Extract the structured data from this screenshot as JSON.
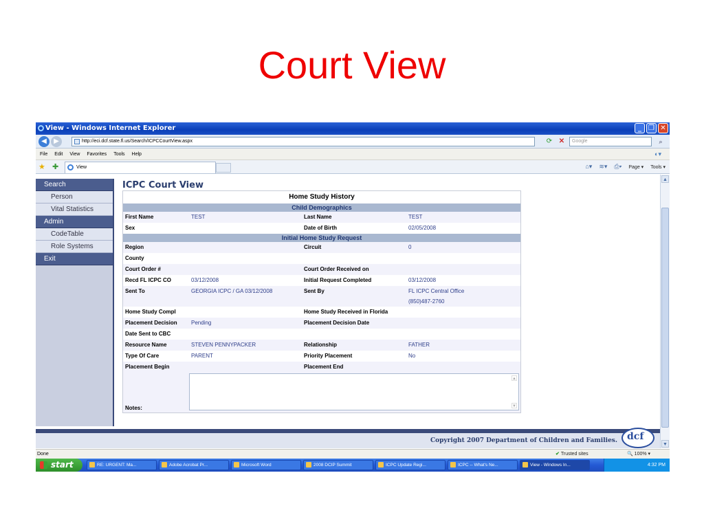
{
  "slide": {
    "title": "Court View"
  },
  "window": {
    "title": "View - Windows Internet Explorer",
    "url": "http://eci.dcf.state.fl.us/Search/ICPCCourtView.aspx",
    "search_placeholder": "Google",
    "menu": [
      "File",
      "Edit",
      "View",
      "Favorites",
      "Tools",
      "Help"
    ],
    "tab_label": "View",
    "commands": [
      "Page",
      "Tools"
    ]
  },
  "nav": {
    "sections": [
      {
        "label": "Search",
        "items": [
          "Person",
          "Vital Statistics"
        ]
      },
      {
        "label": "Admin",
        "items": [
          "CodeTable",
          "Role Systems"
        ]
      },
      {
        "label": "Exit",
        "items": []
      }
    ]
  },
  "page": {
    "title": "ICPC Court View",
    "form_title": "Home Study History",
    "section_child": "Child Demographics",
    "section_request": "Initial Home Study Request",
    "child_rows": [
      {
        "l1": "First Name",
        "v1": "TEST",
        "l2": "Last Name",
        "v2": "TEST"
      },
      {
        "l1": "Sex",
        "v1": "",
        "l2": "Date of Birth",
        "v2": "02/05/2008"
      }
    ],
    "request_rows": [
      {
        "l1": "Region",
        "v1": "",
        "l2": "Circuit",
        "v2": "0"
      },
      {
        "l1": "County",
        "v1": "",
        "l2": "",
        "v2": ""
      },
      {
        "l1": "Court Order #",
        "v1": "",
        "l2": "Court Order Received on",
        "v2": ""
      },
      {
        "l1": "Recd FL ICPC CO",
        "v1": "03/12/2008",
        "l2": "Initial Request Completed",
        "v2": "03/12/2008"
      },
      {
        "l1": "Sent To",
        "v1": "GEORGIA ICPC / GA 03/12/2008",
        "l2": "Sent By",
        "v2": "FL ICPC Central Office",
        "v2b": "(850)487-2760"
      },
      {
        "l1": "Home Study Compl",
        "v1": "",
        "l2": "Home Study Received in Florida",
        "v2": ""
      },
      {
        "l1": "Placement Decision",
        "v1": "Pending",
        "l2": "Placement Decision Date",
        "v2": ""
      },
      {
        "l1": "Date Sent to CBC",
        "v1": "",
        "l2": "",
        "v2": ""
      },
      {
        "l1": "Resource Name",
        "v1": "STEVEN PENNYPACKER",
        "l2": "Relationship",
        "v2": "FATHER"
      },
      {
        "l1": "Type Of Care",
        "v1": "PARENT",
        "l2": "Priority Placement",
        "v2": "No"
      },
      {
        "l1": "Placement Begin",
        "v1": "",
        "l2": "Placement End",
        "v2": ""
      }
    ],
    "notes_label": "Notes:",
    "copyright": "Copyright 2007 Department of Children and Families.",
    "logo_text": "dcf"
  },
  "status": {
    "left": "Done",
    "zone": "Trusted sites",
    "zoom": "100%"
  },
  "taskbar": {
    "start": "start",
    "items": [
      "RE: URGENT: Ma...",
      "Adobe Acrobat Pr...",
      "Microsoft Word",
      "2008 DCIP Summit",
      "ICPC Update Regi...",
      "ICPC -- What's Ne...",
      "View - Windows In..."
    ],
    "clock": "4:32 PM"
  }
}
